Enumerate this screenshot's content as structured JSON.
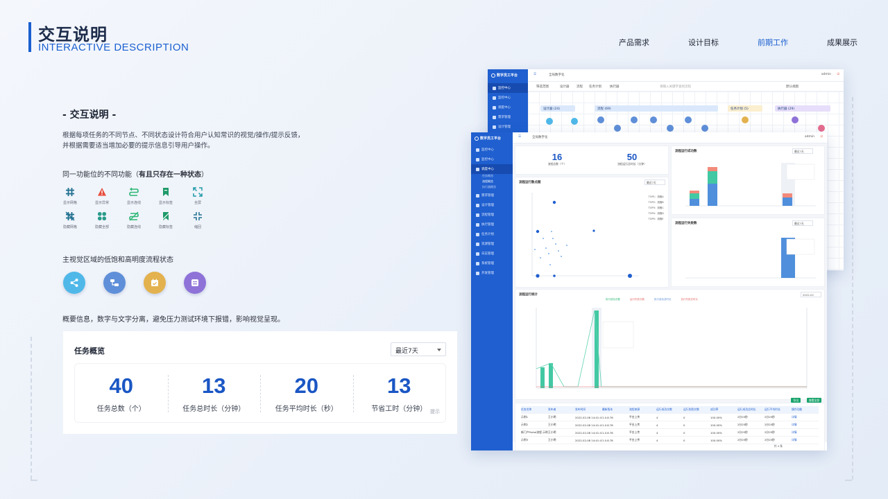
{
  "header": {
    "title_cn": "交互说明",
    "title_en": "INTERACTIVE DESCRIPTION",
    "nav": [
      {
        "label": "产品需求",
        "active": false
      },
      {
        "label": "设计目标",
        "active": false
      },
      {
        "label": "前期工作",
        "active": true
      },
      {
        "label": "成果展示",
        "active": false
      }
    ]
  },
  "section": {
    "title": "- 交互说明 -",
    "desc_line1": "根据每项任务的不同节点、不同状态设计符合用户认知常识的视觉/操作/提示反馈，",
    "desc_line2": "并根据需要适当增加必要的提示信息引导用户操作。",
    "sub1_plain": "同一功能位的不同功能（",
    "sub1_bold": "有且只存在一种状态",
    "sub1_end": "）",
    "icons": [
      {
        "label": "显示网格",
        "icon": "grid-icon",
        "color": "#1f9aa8"
      },
      {
        "label": "显示异常",
        "icon": "warning-icon",
        "color": "#e74c3c"
      },
      {
        "label": "显示连线",
        "icon": "connector-icon",
        "color": "#2bb673"
      },
      {
        "label": "显示标签",
        "icon": "bookmark-icon",
        "color": "#1f9a6a"
      },
      {
        "label": "全屏",
        "icon": "fullscreen-icon",
        "color": "#1f9aa8"
      },
      {
        "label": "隐藏网格",
        "icon": "grid-off-icon",
        "color": "#1f9aa8"
      },
      {
        "label": "隐藏全部",
        "icon": "clover-icon",
        "color": "#2a9b8a"
      },
      {
        "label": "隐藏连线",
        "icon": "connector-off-icon",
        "color": "#2bb673"
      },
      {
        "label": "隐藏标签",
        "icon": "bookmark-off-icon",
        "color": "#1f9a6a"
      },
      {
        "label": "缩回",
        "icon": "collapse-icon",
        "color": "#1f9aa8"
      }
    ],
    "sub2": "主视觉区域的低饱和高明度流程状态",
    "circles": [
      {
        "icon": "share-icon",
        "color": "#4fb8e8"
      },
      {
        "icon": "flow-icon",
        "color": "#5f8fd8"
      },
      {
        "icon": "calendar-icon",
        "color": "#e3b24e"
      },
      {
        "icon": "list-icon",
        "color": "#8e72d8"
      }
    ],
    "note": "概要信息，数字与文字分离，避免压力测试环境下报错，影响视觉呈现。"
  },
  "overview": {
    "title": "任务概览",
    "select_value": "最近7天",
    "items": [
      {
        "value": "40",
        "label": "任务总数（个）"
      },
      {
        "value": "13",
        "label": "任务总时长（分钟）"
      },
      {
        "value": "20",
        "label": "任务平均时长（秒）"
      },
      {
        "value": "13",
        "label": "节省工时（分钟）"
      }
    ],
    "hint": "提示"
  },
  "mock_back": {
    "app_name": "数字员工平台",
    "tab_name": "全局数字化",
    "user": "admin",
    "menu": [
      "监控中心",
      "监控中心",
      "调度中心",
      "需求管理",
      "设计管理"
    ],
    "filter_label": "筛选范围",
    "filters": [
      "设计器",
      "流程",
      "任务计划",
      "执行器"
    ],
    "search_placeholder": "请输入关键字查找流程",
    "view_select": "默认视图",
    "columns": [
      {
        "label": "设计器 (24)",
        "color": "#dbe8fb"
      },
      {
        "label": "流程 (69)",
        "color": "#dbe8fb"
      },
      {
        "label": "任务计划 (5)",
        "color": "#fbefcf"
      },
      {
        "label": "执行器 (29)",
        "color": "#e6defa"
      }
    ]
  },
  "mock_front": {
    "app_name": "数字员工平台",
    "tab_name": "全局数字化",
    "user": "admin",
    "menu": [
      {
        "label": "监控中心",
        "on": false
      },
      {
        "label": "监控中心",
        "on": false
      },
      {
        "label": "调度中心",
        "on": true
      }
    ],
    "submenu": [
      "任务概览",
      "流程概览",
      "执行器概览"
    ],
    "menu_more": [
      "需求管理",
      "设计管理",
      "流程管理",
      "执行管理",
      "任务计划",
      "资源管理",
      "日志管理",
      "系统管理",
      "开发管理"
    ],
    "kpi": [
      {
        "value": "16",
        "label": "流程总数（个）"
      },
      {
        "value": "50",
        "label": "流程运行总时长（分钟）"
      }
    ],
    "panel_titles": {
      "scatter": "流程运行散点图",
      "success": "流程运行成功数",
      "fail": "流程运行失败数",
      "stats": "流程运行统计"
    },
    "select_recent": "最近7天",
    "select_month": "2022-02",
    "scatter_top": [
      "TOP1：流程A",
      "TOP2：流程B",
      "TOP3：流程C",
      "TOP4：流程D",
      "TOP5：流程E"
    ],
    "legend": [
      "执行成功次数",
      "运行失败次数",
      "执行成功总时长",
      "执行失败总时长"
    ],
    "table_headers": [
      "任务名称",
      "发布者",
      "发布时间",
      "最新版本",
      "流程来源",
      "运行成功次数",
      "运行失败次数",
      "成功率",
      "运行成功总时长",
      "运行平均时长",
      "操作功能"
    ],
    "table_rows": [
      [
        "示例1",
        "王小明",
        "2022-02-08 14:41:43",
        "1.0.8.78",
        "平台上传",
        "4",
        "0",
        "100.00%",
        "2分25秒",
        "2分25秒",
        "详情"
      ],
      [
        "示例2",
        "王小明",
        "2022-02-08 14:41:43",
        "1.0.8.78",
        "平台上传",
        "4",
        "0",
        "100.00%",
        "2分25秒",
        "2分25秒",
        "详情"
      ],
      [
        "新门户Portal流程 示例",
        "王小明",
        "2022-02-08 14:41:43",
        "1.0.8.78",
        "平台上传",
        "4",
        "0",
        "100.00%",
        "2分25秒",
        "2分25秒",
        "详情"
      ],
      [
        "示例3",
        "王小明",
        "2022-02-08 14:41:43",
        "1.0.8.78",
        "平台上传",
        "4",
        "0",
        "100.00%",
        "2分25秒",
        "2分25秒",
        "详情"
      ]
    ],
    "btn_export": "导出",
    "btn_all": "查看全部",
    "pagination": "共 4 条"
  }
}
